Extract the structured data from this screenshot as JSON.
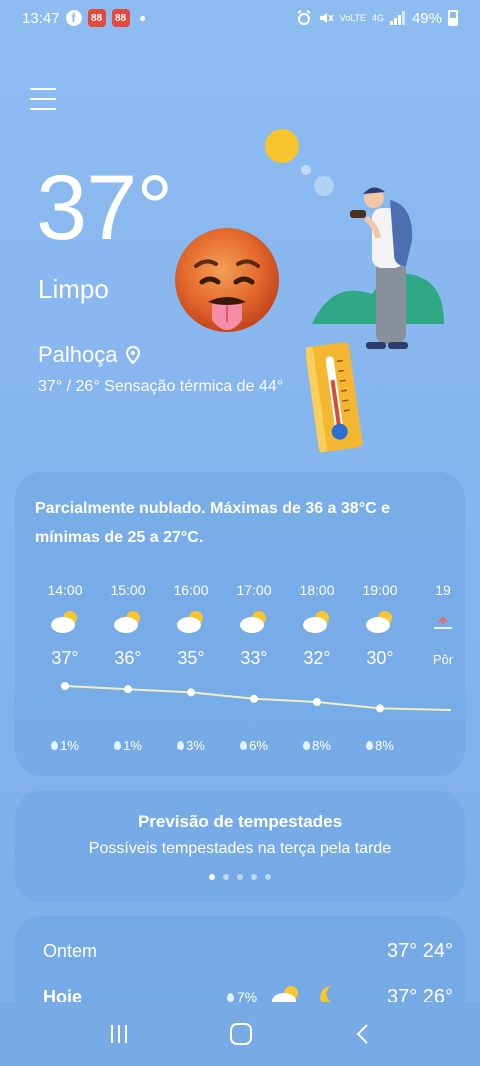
{
  "status_bar": {
    "time": "13:47",
    "app_badge_1": "88",
    "app_badge_2": "88",
    "network_1": "VoLTE",
    "network_2": "4G",
    "battery": "49%"
  },
  "current": {
    "temperature": "37°",
    "condition": "Limpo",
    "location": "Palhoça",
    "minmax_feels": "37° / 26° Sensação térmica de 44°"
  },
  "hourly_card": {
    "summary": "Parcialmente nublado. Máximas de 36 a 38°C e mínimas de 25 a 27°C.",
    "hours": [
      {
        "time": "14:00",
        "temp": "37°",
        "rain": "1%",
        "icon": "partly-cloudy-icon"
      },
      {
        "time": "15:00",
        "temp": "36°",
        "rain": "1%",
        "icon": "partly-cloudy-icon"
      },
      {
        "time": "16:00",
        "temp": "35°",
        "rain": "3%",
        "icon": "partly-cloudy-icon"
      },
      {
        "time": "17:00",
        "temp": "33°",
        "rain": "6%",
        "icon": "partly-cloudy-icon"
      },
      {
        "time": "18:00",
        "temp": "32°",
        "rain": "8%",
        "icon": "partly-cloudy-icon"
      },
      {
        "time": "19:00",
        "temp": "30°",
        "rain": "8%",
        "icon": "partly-cloudy-icon"
      },
      {
        "time": "19",
        "temp": "Pôr",
        "rain": "",
        "icon": "sunset-icon"
      }
    ],
    "temp_values": [
      37,
      36,
      35,
      33,
      32,
      30,
      29.5
    ]
  },
  "storm_card": {
    "title": "Previsão de tempestades",
    "text": "Possíveis tempestades na terça pela tarde",
    "page_count": 5,
    "active_page": 1
  },
  "daily_card": {
    "rows": [
      {
        "day": "Ontem",
        "rain": "",
        "temps": "37° 24°"
      },
      {
        "day": "Hoje",
        "rain": "7%",
        "temps": "37° 26°"
      }
    ]
  },
  "colors": {
    "background": "#8cbcf0",
    "card": "#6ea5e4",
    "sun": "#f7c52e"
  }
}
